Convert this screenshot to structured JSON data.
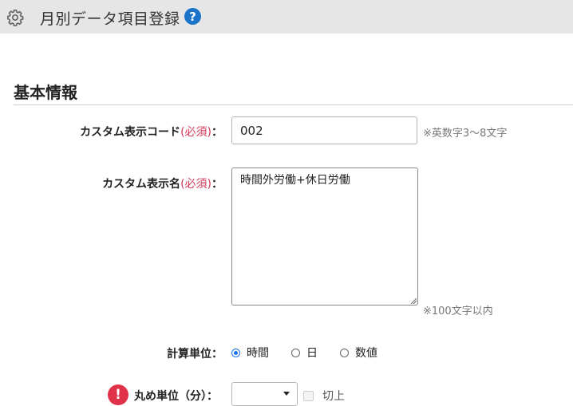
{
  "header": {
    "title": "月別データ項目登録",
    "icons": {
      "settings": "gear-icon",
      "help": "help-icon"
    },
    "help_glyph": "?"
  },
  "section": {
    "title": "基本情報"
  },
  "fields": {
    "code": {
      "label": "カスタム表示コード",
      "required": "(必須)",
      "colon": "：",
      "value": "002",
      "hint": "※英数字3～8文字"
    },
    "name": {
      "label": "カスタム表示名",
      "required": "(必須)",
      "colon": "：",
      "value": "時間外労働+休日労働",
      "hint": "※100文字以内"
    },
    "unit": {
      "label": "計算単位",
      "colon": "：",
      "options": [
        "時間",
        "日",
        "数値"
      ],
      "selected": "時間"
    },
    "rounding": {
      "label": "丸め単位（分）：",
      "alert_glyph": "!",
      "select_value": "",
      "checkbox_label": "切上"
    }
  },
  "colors": {
    "required": "#d43a5a",
    "accent": "#1a73e8",
    "alert": "#e0334a",
    "header_bg": "#e6e6e6"
  }
}
